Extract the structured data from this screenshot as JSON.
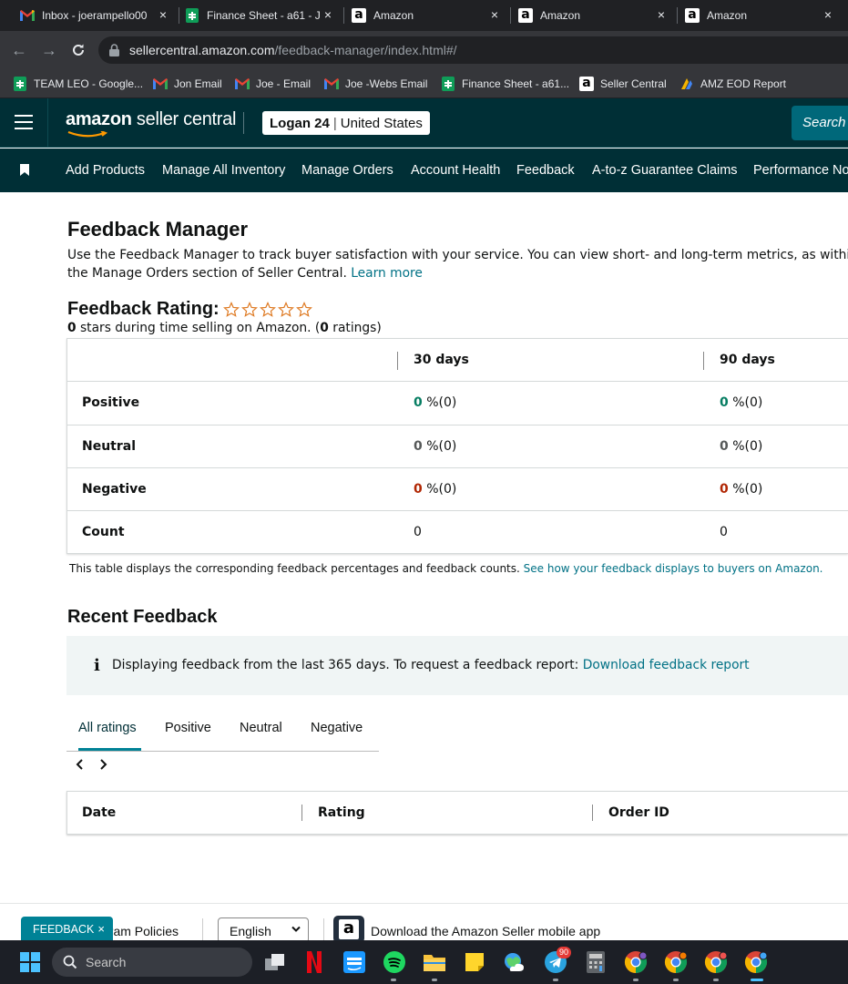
{
  "browser": {
    "tabs": [
      {
        "title": "Inbox - joerampello00",
        "icon": "gmail-icon"
      },
      {
        "title": "Finance Sheet - a61 - J",
        "icon": "sheets-icon"
      },
      {
        "title": "Amazon",
        "icon": "amazon-icon"
      },
      {
        "title": "Amazon",
        "icon": "amazon-icon"
      },
      {
        "title": "Amazon",
        "icon": "amazon-icon"
      }
    ],
    "url_host": "sellercentral.amazon.com",
    "url_path": "/feedback-manager/index.html#/",
    "bookmarks": [
      {
        "label": "TEAM LEO - Google...",
        "icon": "sheets-icon"
      },
      {
        "label": "Jon Email",
        "icon": "gmail-icon"
      },
      {
        "label": "Joe - Email",
        "icon": "gmail-icon"
      },
      {
        "label": "Joe -Webs Email",
        "icon": "gmail-icon"
      },
      {
        "label": "Finance Sheet - a61...",
        "icon": "sheets-icon"
      },
      {
        "label": "Seller Central",
        "icon": "amazon-icon"
      },
      {
        "label": "AMZ EOD Report",
        "icon": "amz-eod-icon"
      }
    ]
  },
  "header": {
    "logo_bold": "amazon",
    "logo_rest": " seller central",
    "account_name": "Logan 24",
    "account_sep": "|",
    "account_region": "United States",
    "search_label": "Search"
  },
  "nav": {
    "items": [
      "Add Products",
      "Manage All Inventory",
      "Manage Orders",
      "Account Health",
      "Feedback",
      "A-to-z Guarantee Claims",
      "Performance No"
    ]
  },
  "page": {
    "title": "Feedback Manager",
    "intro": "Use the Feedback Manager to track buyer satisfaction with your service. You can view short- and long-term metrics, as within the Manage Orders section of Seller Central.",
    "intro_link": "Learn more",
    "rating_title": "Feedback Rating:",
    "rating_stars": 0,
    "rating_max_stars": 5,
    "rating_sub_stars": "0",
    "rating_sub_mid": " stars during time selling on Amazon. (",
    "rating_sub_count": "0",
    "rating_sub_end": " ratings)"
  },
  "metrics": {
    "columns": [
      "30 days",
      "90 days"
    ],
    "rows": [
      {
        "label": "Positive",
        "d30_pct": "0",
        "d30_rest": " %(0)",
        "d90_pct": "0",
        "d90_rest": " %(0)"
      },
      {
        "label": "Neutral",
        "d30_pct": "0",
        "d30_rest": " %(0)",
        "d90_pct": "0",
        "d90_rest": " %(0)"
      },
      {
        "label": "Negative",
        "d30_pct": "0",
        "d30_rest": " %(0)",
        "d90_pct": "0",
        "d90_rest": " %(0)"
      },
      {
        "label": "Count",
        "d30": "0",
        "d90": "0"
      }
    ],
    "note": "This table displays the corresponding feedback percentages and feedback counts.",
    "note_link": "See how your feedback displays to buyers on Amazon."
  },
  "recent": {
    "title": "Recent Feedback",
    "info_text": "Displaying feedback from the last 365 days. To request a feedback report:",
    "info_link": "Download feedback report",
    "tabs": [
      "All ratings",
      "Positive",
      "Neutral",
      "Negative"
    ],
    "active_tab": "All ratings",
    "columns": [
      "Date",
      "Rating",
      "Order ID"
    ]
  },
  "footer": {
    "policies": "gram Policies",
    "language": "English",
    "app_text": "Download the Amazon Seller mobile app",
    "feedback_pill": "FEEDBACK",
    "feedback_close": "×"
  },
  "taskbar": {
    "search_placeholder": "Search",
    "telegram_badge": "90"
  },
  "colors": {
    "header_bg": "#002f36",
    "link": "#007185",
    "positive": "#067d62",
    "negative": "#b12704",
    "accent": "#008296"
  }
}
